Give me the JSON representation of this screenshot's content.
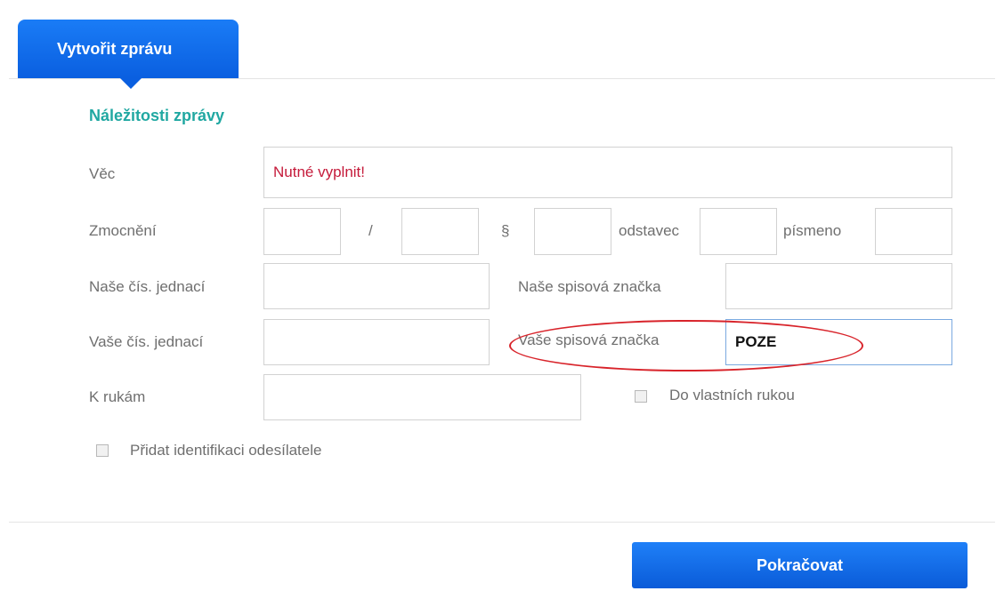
{
  "tab": {
    "label": "Vytvořit zprávu"
  },
  "section": {
    "title": "Náležitosti zprávy"
  },
  "fields": {
    "vec": {
      "label": "Věc",
      "placeholder": "Nutné vyplnit!"
    },
    "zmocneni": {
      "label": "Zmocnění",
      "slash": "/",
      "paragraph": "§",
      "odstavec": "odstavec",
      "pismeno": "písmeno"
    },
    "nase_cj": {
      "label": "Naše čís. jednací"
    },
    "nase_sz": {
      "label": "Naše spisová značka"
    },
    "vase_cj": {
      "label": "Vaše čís. jednací"
    },
    "vase_sz": {
      "label": "Vaše spisová značka",
      "value": "POZE"
    },
    "k_rukam": {
      "label": "K rukám"
    },
    "do_vlastnich": {
      "label": "Do vlastních rukou"
    },
    "identifikace": {
      "label": "Přidat identifikaci odesílatele"
    }
  },
  "actions": {
    "continue_label": "Pokračovat"
  },
  "colors": {
    "accent_blue": "#0a5fe0",
    "section_title": "#21a8a2",
    "error_text": "#c51a3a",
    "annotation": "#d8232a"
  }
}
